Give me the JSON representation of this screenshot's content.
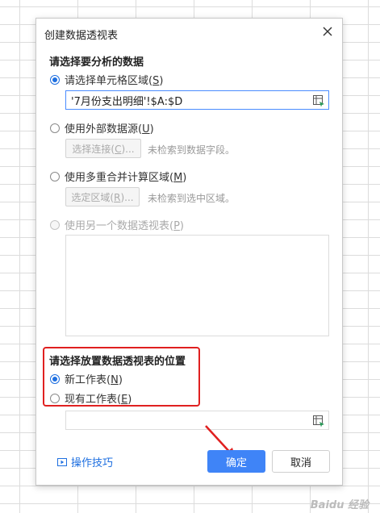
{
  "dialog": {
    "title": "创建数据透视表"
  },
  "source_section": {
    "title": "请选择要分析的数据",
    "option_range": {
      "text": "请选择单元格区域(",
      "key": "S",
      "tail": ")",
      "selected": true
    },
    "range_value": "'7月份支出明细'!$A:$D",
    "option_external": {
      "text": "使用外部数据源(",
      "key": "U",
      "tail": ")",
      "selected": false
    },
    "select_connection": {
      "text": "选择连接(",
      "key": "C",
      "tail": ")..."
    },
    "external_hint": "未检索到数据字段。",
    "option_consolidate": {
      "text": "使用多重合并计算区域(",
      "key": "M",
      "tail": ")",
      "selected": false
    },
    "select_range": {
      "text": "选定区域(",
      "key": "R",
      "tail": ")..."
    },
    "consolidate_hint": "未检索到选中区域。",
    "option_other_pivot": {
      "text": "使用另一个数据透视表(",
      "key": "P",
      "tail": ")",
      "selected": false,
      "disabled": true
    }
  },
  "location_section": {
    "title": "请选择放置数据透视表的位置",
    "option_new_sheet": {
      "text": "新工作表(",
      "key": "N",
      "tail": ")",
      "selected": true
    },
    "option_existing_sheet": {
      "text": "现有工作表(",
      "key": "E",
      "tail": ")",
      "selected": false
    },
    "location_value": ""
  },
  "footer": {
    "tips_label": "操作技巧",
    "ok_label": "确定",
    "cancel_label": "取消"
  },
  "colors": {
    "accent": "#3f84f7",
    "highlight": "#e02020"
  },
  "watermark": "Baidu 经验"
}
